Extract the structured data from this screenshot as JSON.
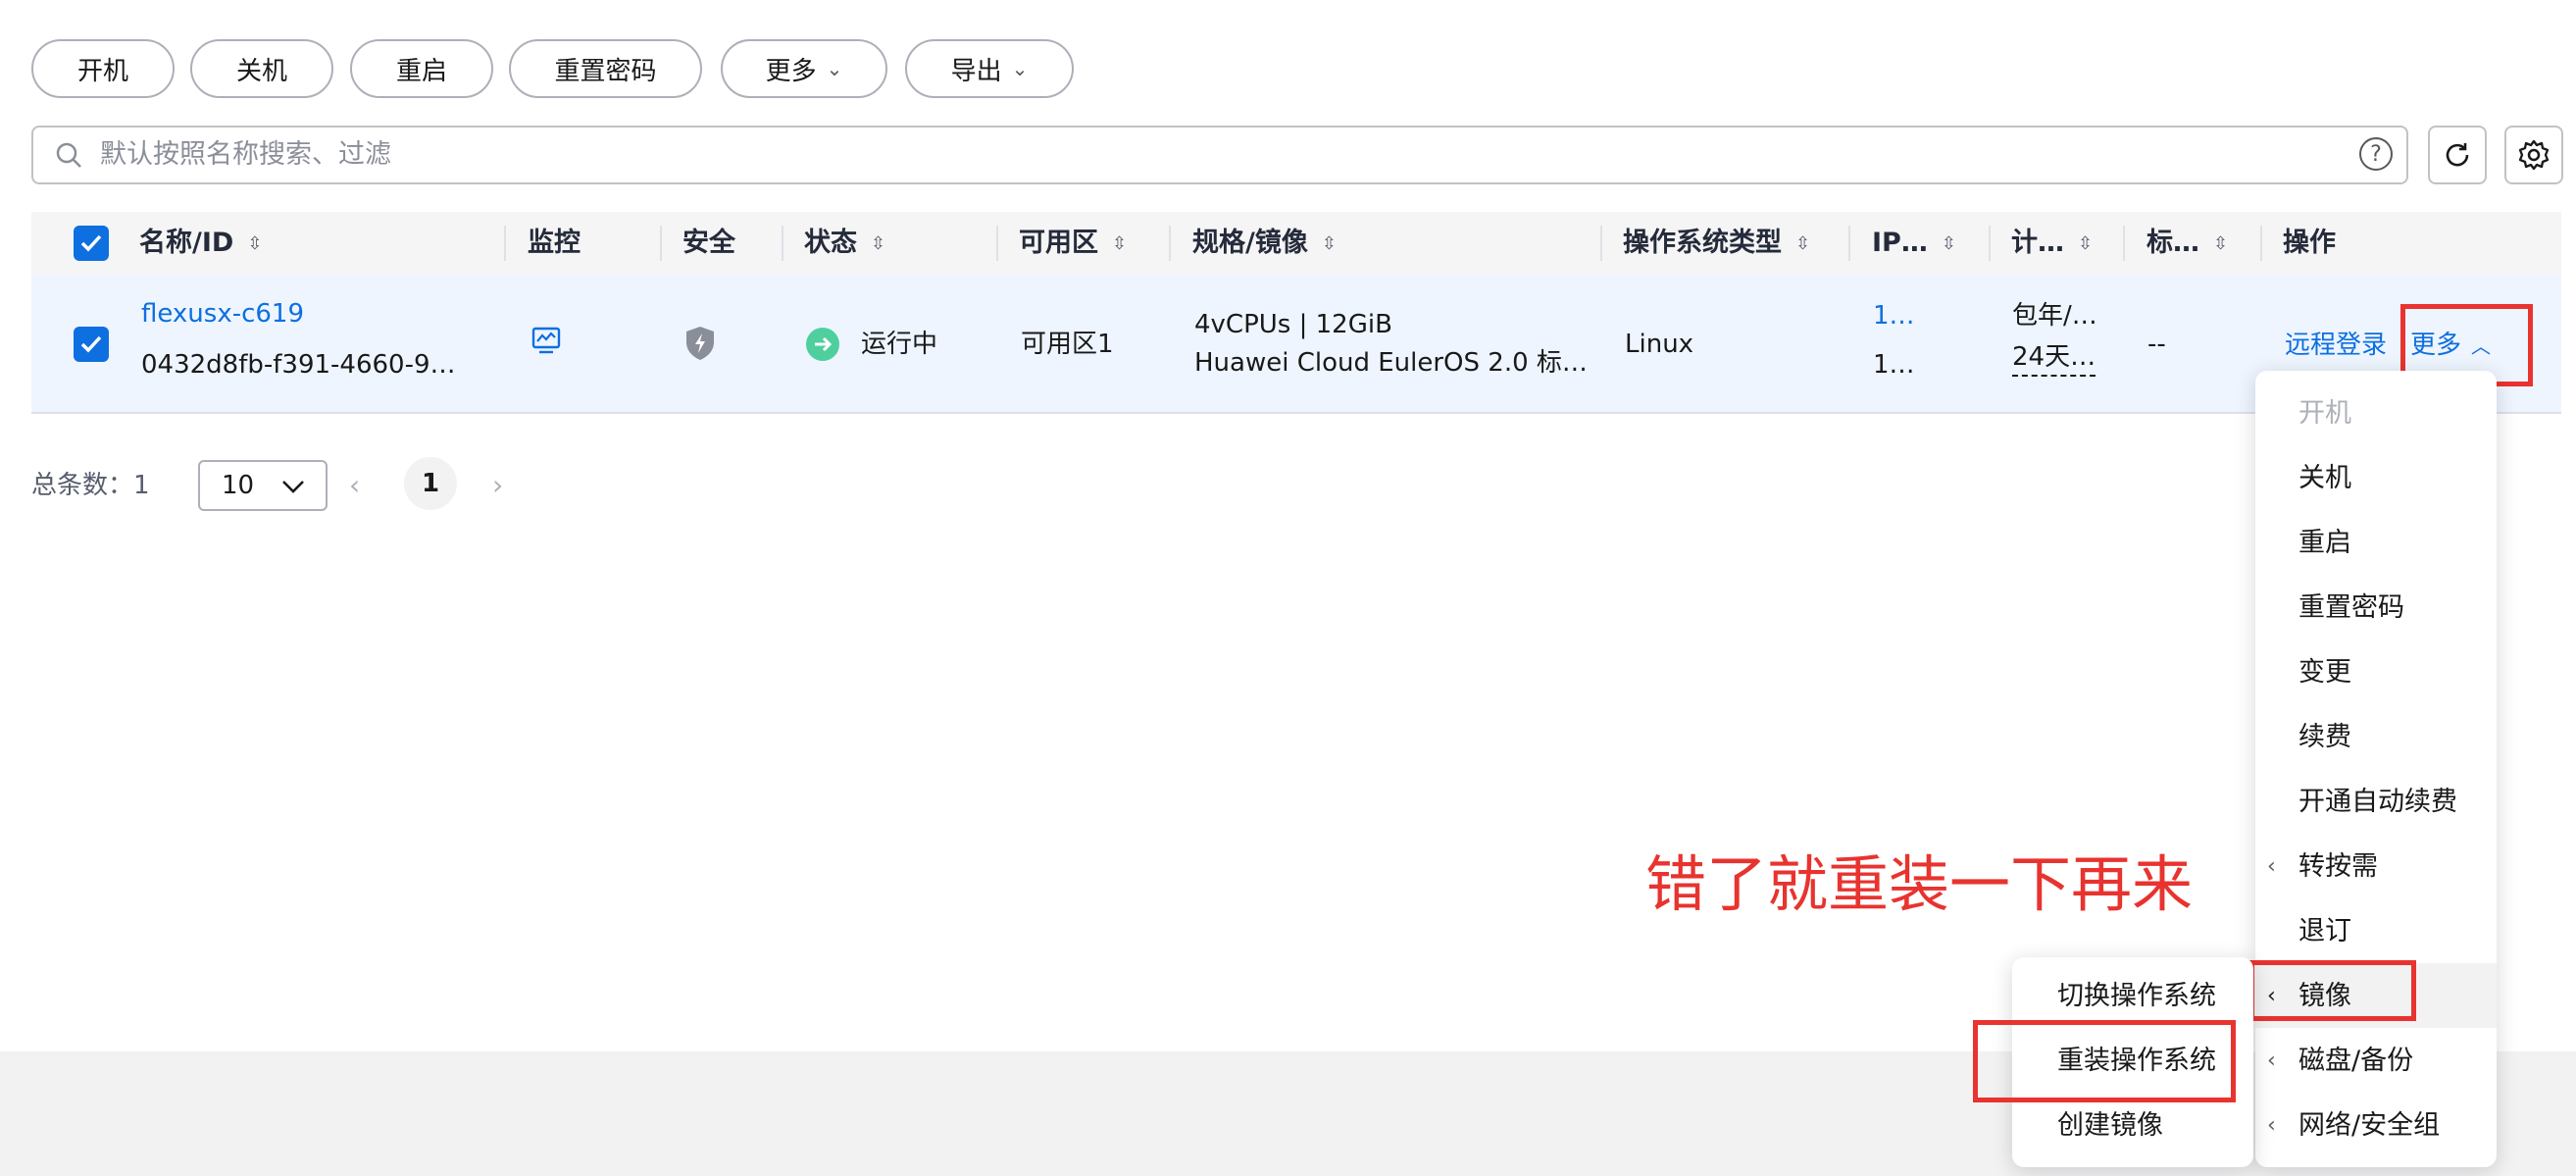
{
  "toolbar": {
    "buttons": [
      "开机",
      "关机",
      "重启",
      "重置密码"
    ],
    "more_label": "更多",
    "export_label": "导出"
  },
  "search": {
    "placeholder": "默认按照名称搜索、过滤"
  },
  "table": {
    "headers": {
      "name": "名称/ID",
      "monitor": "监控",
      "security": "安全",
      "status": "状态",
      "zone": "可用区",
      "spec": "规格/镜像",
      "os": "操作系统类型",
      "ip": "IP…",
      "billing": "计…",
      "tag": "标…",
      "ops": "操作"
    },
    "row": {
      "name": "flexusx-c619",
      "id": "0432d8fb-f391-4660-9…",
      "status": "运行中",
      "zone": "可用区1",
      "spec": "4vCPUs | 12GiB",
      "image": "Huawei Cloud EulerOS 2.0 标…",
      "os": "Linux",
      "ip1": "1…",
      "ip2": "1…",
      "billing1": "包年/…",
      "billing2": "24天…",
      "tag": "--",
      "remote_login": "远程登录",
      "more": "更多"
    }
  },
  "pagination": {
    "total_label": "总条数：1",
    "page_size": "10",
    "current_page": "1"
  },
  "menu": {
    "items": [
      "开机",
      "关机",
      "重启",
      "重置密码",
      "变更",
      "续费",
      "开通自动续费",
      "转按需",
      "退订",
      "镜像",
      "磁盘/备份",
      "网络/安全组"
    ]
  },
  "submenu": {
    "items": [
      "切换操作系统",
      "重装操作系统",
      "创建镜像"
    ]
  },
  "annotation": "错了就重装一下再来",
  "colors": {
    "accent": "#0d6fe0",
    "annotation_red": "#e8332f",
    "running_green": "#4fcf9e"
  }
}
